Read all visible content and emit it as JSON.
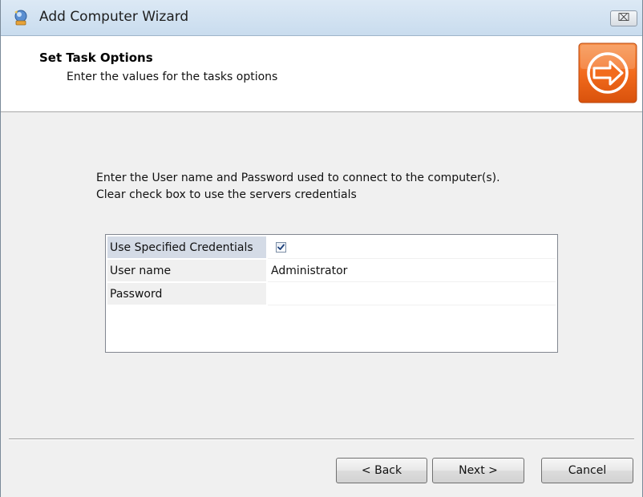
{
  "window": {
    "title": "Add Computer Wizard",
    "close_label": "⌧"
  },
  "header": {
    "title": "Set Task Options",
    "subtitle": "Enter the values for the tasks options",
    "logo_icon": "orange-arrow-icon"
  },
  "instructions": {
    "line1": "Enter the User name and Password used to connect to the computer(s).",
    "line2": "Clear check box to use the servers credentials"
  },
  "grid": {
    "rows": [
      {
        "label": "Use Specified Credentials",
        "value": "",
        "type": "checkbox",
        "checked": true
      },
      {
        "label": "User name",
        "value": "Administrator",
        "type": "text"
      },
      {
        "label": "Password",
        "value": "",
        "type": "password"
      }
    ]
  },
  "footer": {
    "back_label": "< Back",
    "next_label": "Next >",
    "cancel_label": "Cancel"
  },
  "colors": {
    "logo_orange": "#f26b1d",
    "selected_row": "#d4dbe6",
    "checkmark": "#1b3f7a"
  }
}
